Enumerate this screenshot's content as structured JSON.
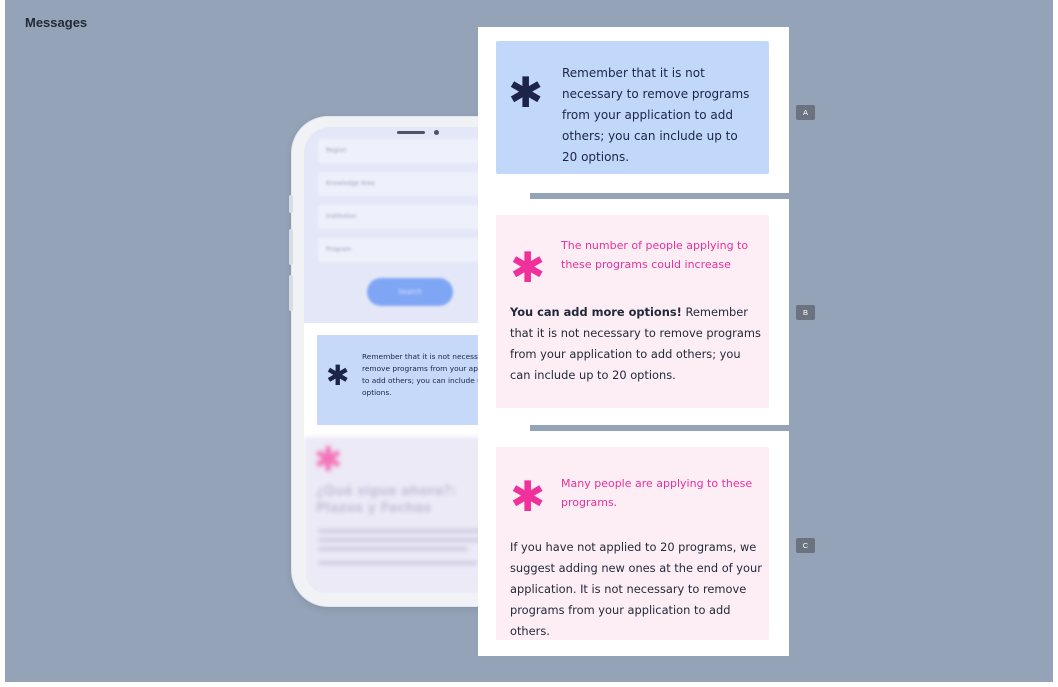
{
  "page": {
    "title": "Messages"
  },
  "phone": {
    "form_fields": [
      "Region",
      "Knowledge Area",
      "Institution",
      "Program"
    ],
    "submit_label": "Search",
    "message": "Remember that it is not necessary to remove programs from your application to add others; you can include up to 20 options.",
    "bottom_title": "¿Qué sigue ahora?: Plazos y Fechas",
    "icon": "asterisk-icon"
  },
  "cards": {
    "a": {
      "tag": "A",
      "icon": "asterisk-icon",
      "text": "Remember that it is not necessary to remove programs from your application to add others; you can include up to 20 options."
    },
    "b": {
      "tag": "B",
      "icon": "asterisk-icon",
      "headline": "The number of people applying to these programs could increase",
      "body_bold": "You can add more options!",
      "body": " Remember that it is not necessary to remove programs from your application to add others; you can include up to 20 options."
    },
    "c": {
      "tag": "C",
      "icon": "asterisk-icon",
      "headline": "Many people are applying to these programs.",
      "body": "If you have not applied to 20 programs, we suggest adding new ones at the end of your application. It is not necessary to remove programs from your application to add others."
    }
  },
  "colors": {
    "background": "#94a3b8",
    "card_blue": "#c2d8fa",
    "card_pink": "#fdedf5",
    "accent_pink": "#f0319b",
    "navy": "#1c2449"
  }
}
